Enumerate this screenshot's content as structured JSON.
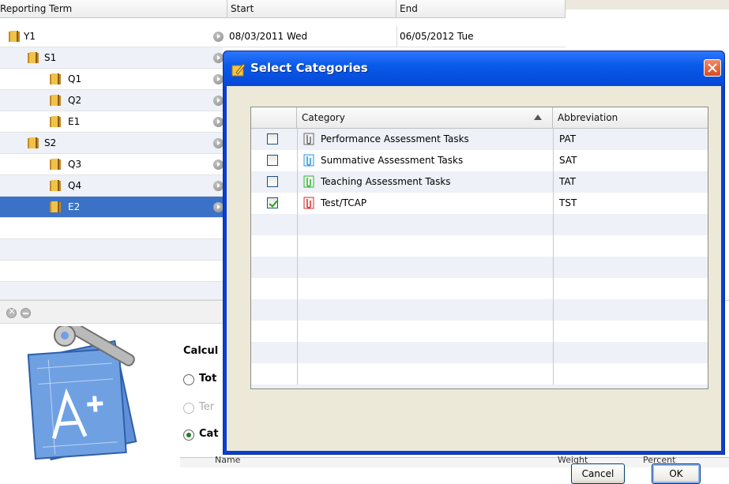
{
  "tree": {
    "headers": {
      "term": "Reporting Term",
      "start": "Start",
      "end": "End"
    },
    "rows": [
      {
        "label": "Y1",
        "start": "08/03/2011 Wed",
        "end": "06/05/2012 Tue"
      },
      {
        "label": "S1",
        "start": "",
        "end": ""
      },
      {
        "label": "Q1",
        "start": "",
        "end": ""
      },
      {
        "label": "Q2",
        "start": "",
        "end": ""
      },
      {
        "label": "E1",
        "start": "",
        "end": ""
      },
      {
        "label": "S2",
        "start": "",
        "end": ""
      },
      {
        "label": "Q3",
        "start": "",
        "end": ""
      },
      {
        "label": "Q4",
        "start": "",
        "end": ""
      },
      {
        "label": "E2",
        "start": "",
        "end": ""
      }
    ]
  },
  "lower": {
    "calc_label": "Calcul",
    "radios": [
      {
        "label": "Tot",
        "checked": false,
        "disabled": false
      },
      {
        "label": "Ter",
        "checked": false,
        "disabled": true
      },
      {
        "label": "Cat",
        "checked": true,
        "disabled": false
      }
    ],
    "bottom_headers": [
      "Name",
      "Weight",
      "Percent"
    ]
  },
  "dialog": {
    "title": "Select Categories",
    "headers": {
      "category": "Category",
      "abbreviation": "Abbreviation"
    },
    "rows": [
      {
        "checked": false,
        "name": "Performance Assessment Tasks",
        "abbr": "PAT",
        "icon_color": "#666666"
      },
      {
        "checked": false,
        "name": "Summative Assessment Tasks",
        "abbr": "SAT",
        "icon_color": "#2a9be0"
      },
      {
        "checked": false,
        "name": "Teaching Assessment Tasks",
        "abbr": "TAT",
        "icon_color": "#2fb52f"
      },
      {
        "checked": true,
        "name": "Test/TCAP",
        "abbr": "TST",
        "icon_color": "#d93030"
      }
    ],
    "cancel_label": "Cancel",
    "ok_label": "OK"
  }
}
